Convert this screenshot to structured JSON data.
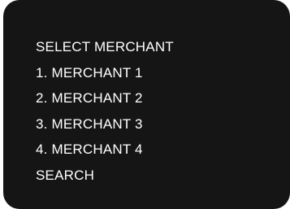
{
  "menu": {
    "title": "SELECT MERCHANT",
    "items": [
      {
        "label": "1. MERCHANT 1"
      },
      {
        "label": "2. MERCHANT 2"
      },
      {
        "label": "3. MERCHANT 3"
      },
      {
        "label": "4. MERCHANT 4"
      }
    ],
    "search_label": "SEARCH"
  },
  "colors": {
    "screen_background": "#151515",
    "text": "#ffffff",
    "page_background": "#ffffff"
  }
}
